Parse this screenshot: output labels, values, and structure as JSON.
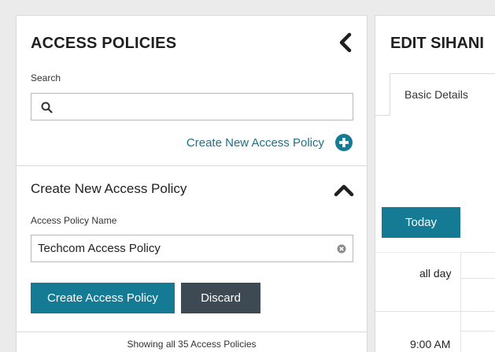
{
  "left": {
    "title": "ACCESS POLICIES",
    "search_label": "Search",
    "create_link": "Create New Access Policy",
    "section_title": "Create New Access Policy",
    "name_label": "Access Policy Name",
    "name_value": "Techcom Access Policy",
    "create_button": "Create Access Policy",
    "discard_button": "Discard",
    "footer": "Showing all 35 Access Policies"
  },
  "right": {
    "title": "EDIT SIHANI",
    "tab": "Basic Details",
    "today_button": "Today",
    "all_day": "all day",
    "time": "9:00 AM"
  },
  "colors": {
    "accent": "#157b94",
    "link": "#1e6f85",
    "dark_button": "#3d4a53"
  },
  "icons": [
    "chevron-left-icon",
    "search-icon",
    "plus-circle-icon",
    "chevron-up-icon",
    "clear-icon"
  ]
}
